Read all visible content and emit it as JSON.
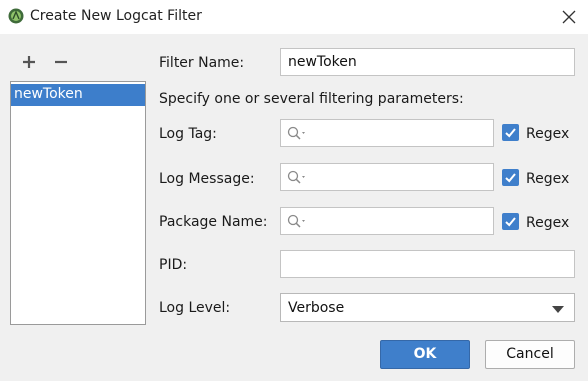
{
  "window": {
    "title": "Create New Logcat Filter"
  },
  "toolbar": {
    "add_symbol": "+",
    "remove_symbol": "−"
  },
  "filters": [
    {
      "name": "newToken",
      "selected": true
    }
  ],
  "form": {
    "filter_name": {
      "label": "Filter Name:",
      "value": "newToken"
    },
    "hint": "Specify one or several filtering parameters:",
    "log_tag": {
      "label": "Log Tag:",
      "value": "",
      "regex": true
    },
    "log_message": {
      "label": "Log Message:",
      "value": "",
      "regex": true
    },
    "package_name": {
      "label": "Package Name:",
      "value": "",
      "regex": true
    },
    "pid": {
      "label": "PID:",
      "value": ""
    },
    "log_level": {
      "label": "Log Level:",
      "value": "Verbose"
    },
    "regex_label": "Regex"
  },
  "buttons": {
    "ok": "OK",
    "cancel": "Cancel"
  },
  "colors": {
    "accent": "#3f7fcb",
    "selection": "#3d7ecb",
    "background": "#f0f0f0"
  },
  "icons": {
    "app": "android-studio-icon",
    "close": "close-icon",
    "search": "search-icon"
  }
}
